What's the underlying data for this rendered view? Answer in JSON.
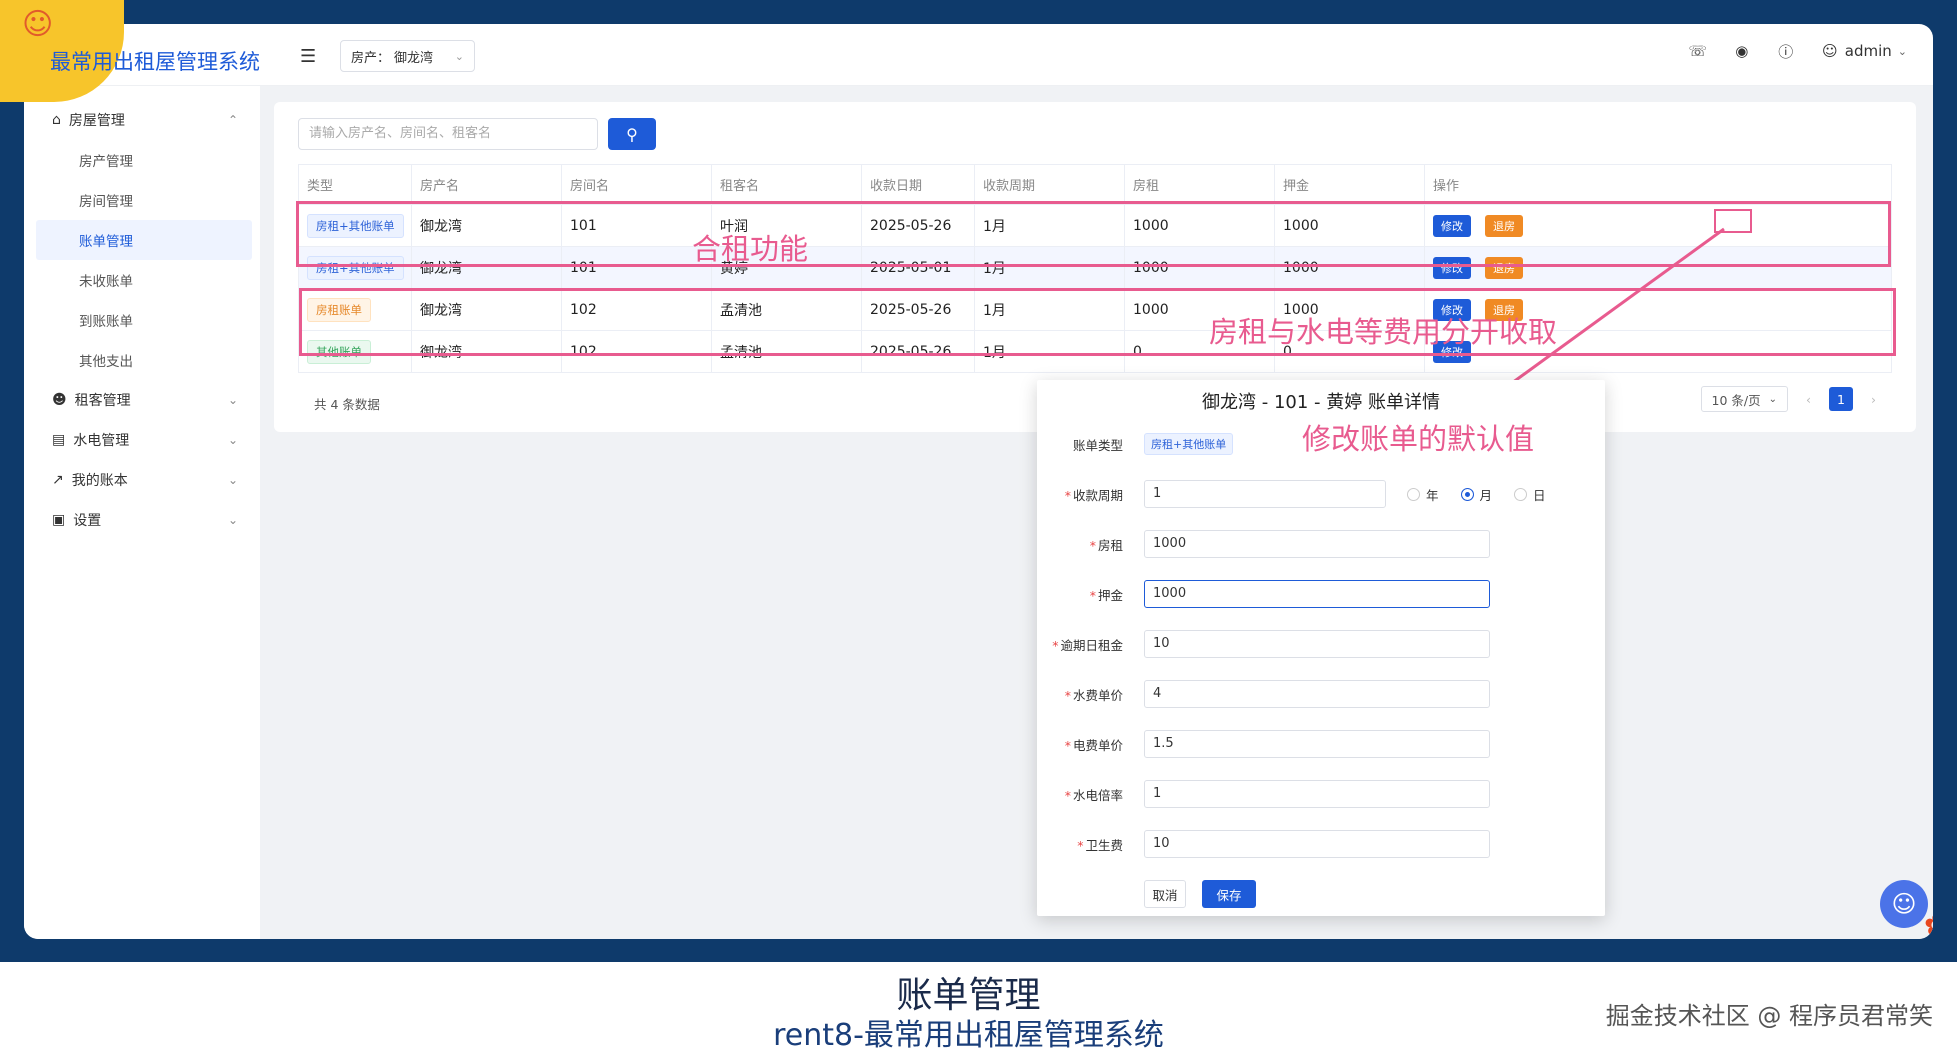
{
  "app": {
    "title": "最常用出租屋管理系统"
  },
  "header": {
    "property_label": "房产：",
    "property_value": "御龙湾",
    "user": "admin"
  },
  "sidebar": {
    "group_house": "房屋管理",
    "items": [
      "房产管理",
      "房间管理",
      "账单管理",
      "未收账单",
      "到账账单",
      "其他支出"
    ],
    "group_tenant": "租客管理",
    "group_utility": "水电管理",
    "group_mybill": "我的账本",
    "group_settings": "设置"
  },
  "search": {
    "placeholder": "请输入房产名、房间名、租客名"
  },
  "table": {
    "columns": [
      "类型",
      "房产名",
      "房间名",
      "租客名",
      "收款日期",
      "收款周期",
      "房租",
      "押金",
      "操作"
    ],
    "rows": [
      {
        "type": "房租+其他账单",
        "property": "御龙湾",
        "room": "101",
        "tenant": "叶润",
        "date": "2025-05-26",
        "cycle": "1月",
        "rent": "1000",
        "deposit": "1000",
        "edit": "修改",
        "checkout": "退房"
      },
      {
        "type": "房租+其他账单",
        "property": "御龙湾",
        "room": "101",
        "tenant": "黄婷",
        "date": "2025-05-01",
        "cycle": "1月",
        "rent": "1000",
        "deposit": "1000",
        "edit": "修改",
        "checkout": "退房"
      },
      {
        "type": "房租账单",
        "property": "御龙湾",
        "room": "102",
        "tenant": "孟清池",
        "date": "2025-05-26",
        "cycle": "1月",
        "rent": "1000",
        "deposit": "1000",
        "edit": "修改",
        "checkout": "退房"
      },
      {
        "type": "其他账单",
        "property": "御龙湾",
        "room": "102",
        "tenant": "孟清池",
        "date": "2025-05-26",
        "cycle": "1月",
        "rent": "0",
        "deposit": "0",
        "edit": "修改"
      }
    ]
  },
  "pagination": {
    "total": "共 4 条数据",
    "page_size": "10 条/页",
    "current": "1"
  },
  "annotations": {
    "shared_rent": "合租功能",
    "split_fees": "房租与水电等费用分开收取",
    "edit_default": "修改账单的默认值"
  },
  "dialog": {
    "title": "御龙湾 - 101 - 黄婷 账单详情",
    "bill_type_label": "账单类型",
    "bill_type_value": "房租+其他账单",
    "cycle_label": "收款周期",
    "cycle_value": "1",
    "cycle_units": [
      "年",
      "月",
      "日"
    ],
    "cycle_unit_selected": "月",
    "rent_label": "房租",
    "rent_value": "1000",
    "deposit_label": "押金",
    "deposit_value": "1000",
    "late_fee_label": "逾期日租金",
    "late_fee_value": "10",
    "water_label": "水费单价",
    "water_value": "4",
    "electric_label": "电费单价",
    "electric_value": "1.5",
    "multiplier_label": "水电倍率",
    "multiplier_value": "1",
    "sanitation_label": "卫生费",
    "sanitation_value": "10",
    "cancel": "取消",
    "save": "保存"
  },
  "caption": {
    "line1": "账单管理",
    "line2": "rent8-最常用出租屋管理系统",
    "watermark": "掘金技术社区 @ 程序员君常笑"
  }
}
